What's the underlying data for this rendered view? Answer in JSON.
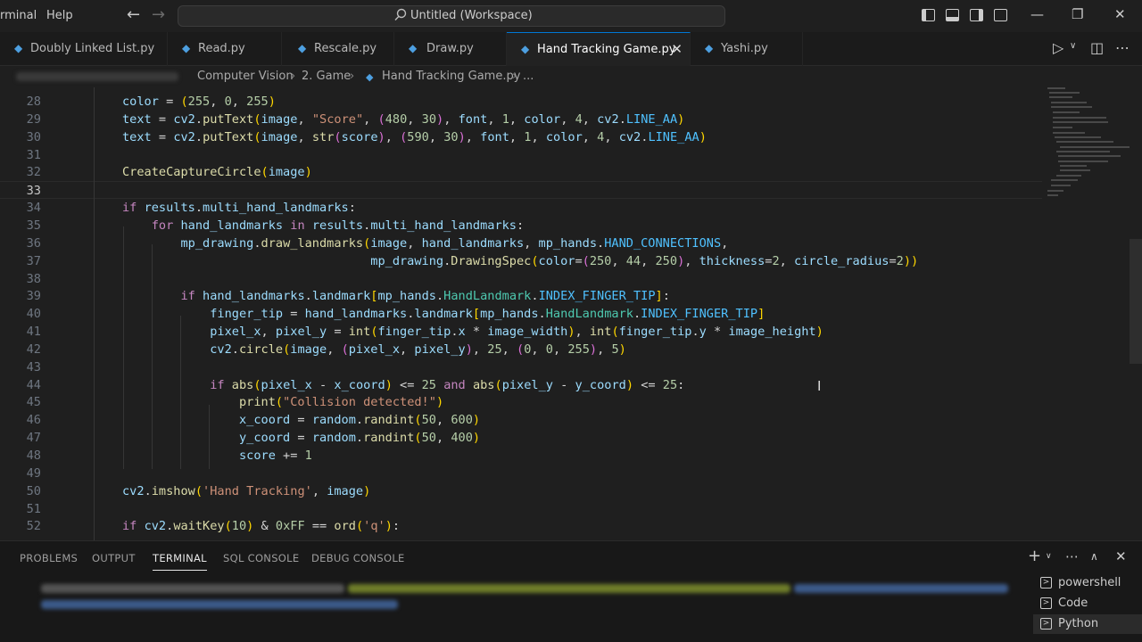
{
  "menu": {
    "terminal": "rminal",
    "help": "Help"
  },
  "command_center": {
    "label": "Untitled (Workspace)"
  },
  "tabs": [
    {
      "label": "Doubly Linked List.py"
    },
    {
      "label": "Read.py"
    },
    {
      "label": "Rescale.py"
    },
    {
      "label": "Draw.py"
    },
    {
      "label": "Hand Tracking Game.py",
      "active": true
    },
    {
      "label": "Yashi.py"
    }
  ],
  "breadcrumb": {
    "part1": "Computer Vision",
    "part2": "2. Game",
    "part3": "Hand Tracking Game.py",
    "part4": "..."
  },
  "editor": {
    "current_line": 33,
    "lines": [
      {
        "n": "28",
        "code": "color = (255, 0, 255)"
      },
      {
        "n": "29",
        "code": "text = cv2.putText(image, \"Score\", (480, 30), font, 1, color, 4, cv2.LINE_AA)"
      },
      {
        "n": "30",
        "code": "text = cv2.putText(image, str(score), (590, 30), font, 1, color, 4, cv2.LINE_AA)"
      },
      {
        "n": "31",
        "code": ""
      },
      {
        "n": "32",
        "code": "CreateCaptureCircle(image)"
      },
      {
        "n": "33",
        "code": ""
      },
      {
        "n": "34",
        "code": "if results.multi_hand_landmarks:"
      },
      {
        "n": "35",
        "code": "    for hand_landmarks in results.multi_hand_landmarks:"
      },
      {
        "n": "36",
        "code": "        mp_drawing.draw_landmarks(image, hand_landmarks, mp_hands.HAND_CONNECTIONS,"
      },
      {
        "n": "37",
        "code": "                                  mp_drawing.DrawingSpec(color=(250, 44, 250), thickness=2, circle_radius=2))"
      },
      {
        "n": "38",
        "code": ""
      },
      {
        "n": "39",
        "code": "        if hand_landmarks.landmark[mp_hands.HandLandmark.INDEX_FINGER_TIP]:"
      },
      {
        "n": "40",
        "code": "            finger_tip = hand_landmarks.landmark[mp_hands.HandLandmark.INDEX_FINGER_TIP]"
      },
      {
        "n": "41",
        "code": "            pixel_x, pixel_y = int(finger_tip.x * image_width), int(finger_tip.y * image_height)"
      },
      {
        "n": "42",
        "code": "            cv2.circle(image, (pixel_x, pixel_y), 25, (0, 0, 255), 5)"
      },
      {
        "n": "43",
        "code": ""
      },
      {
        "n": "44",
        "code": "            if abs(pixel_x - x_coord) <= 25 and abs(pixel_y - y_coord) <= 25:"
      },
      {
        "n": "45",
        "code": "                print(\"Collision detected!\")"
      },
      {
        "n": "46",
        "code": "                x_coord = random.randint(50, 600)"
      },
      {
        "n": "47",
        "code": "                y_coord = random.randint(50, 400)"
      },
      {
        "n": "48",
        "code": "                score += 1"
      },
      {
        "n": "49",
        "code": ""
      },
      {
        "n": "50",
        "code": "cv2.imshow('Hand Tracking', image)"
      },
      {
        "n": "51",
        "code": ""
      },
      {
        "n": "52",
        "code": "if cv2.waitKey(10) & 0xFF == ord('q'):"
      }
    ]
  },
  "panel": {
    "tabs": [
      {
        "label": "PROBLEMS"
      },
      {
        "label": "OUTPUT"
      },
      {
        "label": "TERMINAL",
        "active": true
      },
      {
        "label": "SQL CONSOLE"
      },
      {
        "label": "DEBUG CONSOLE"
      }
    ],
    "terminals": [
      {
        "label": "powershell"
      },
      {
        "label": "Code"
      },
      {
        "label": "Python",
        "active": true
      }
    ]
  },
  "colors": {
    "accent": "#0078d4",
    "editor_bg": "#1f1f1f",
    "keyword": "#c586c0",
    "function": "#dcdcaa",
    "string": "#ce9178",
    "number": "#b5cea8",
    "variable": "#9cdcfe"
  },
  "icons": [
    "search-icon",
    "python-file-icon",
    "close-icon",
    "run-icon",
    "split-editor-icon",
    "more-icon",
    "plus-icon",
    "chevron-down-icon",
    "chevron-up-icon",
    "terminal-icon"
  ]
}
